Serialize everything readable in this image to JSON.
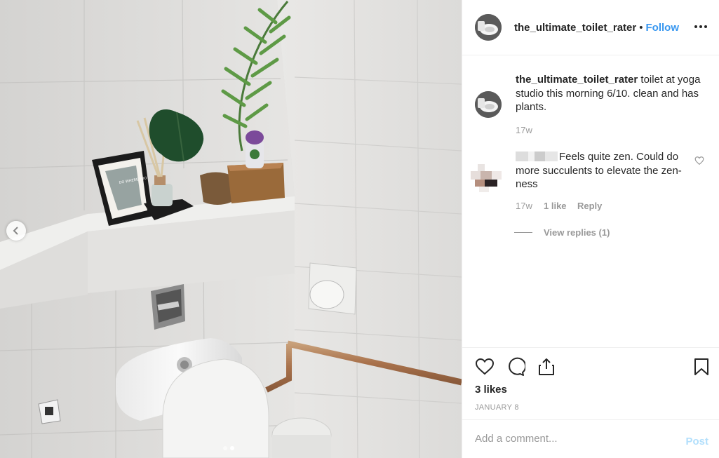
{
  "post": {
    "username": "the_ultimate_toilet_rater",
    "separator": "•",
    "follow_label": "Follow",
    "more_icon": "more-options-icon"
  },
  "caption": {
    "username": "the_ultimate_toilet_rater",
    "text": "toilet at yoga studio this morning 6/10. clean and has plants.",
    "time": "17w"
  },
  "comment": {
    "text": "Feels quite zen. Could do more succulents to elevate the zen-ness",
    "time": "17w",
    "likes": "1 like",
    "reply_label": "Reply"
  },
  "view_replies": "View replies (1)",
  "actions": {
    "like_icon": "heart-icon",
    "comment_icon": "comment-icon",
    "share_icon": "share-icon",
    "save_icon": "bookmark-icon"
  },
  "likes_count": "3 likes",
  "date": "JANUARY 8",
  "add_comment": {
    "placeholder": "Add a comment...",
    "post_label": "Post"
  },
  "carousel": {
    "total": 2,
    "active_index": 1
  },
  "colors": {
    "follow": "#3897f0",
    "post_disabled": "#b2dffc",
    "muted": "#999999",
    "text": "#262626"
  }
}
